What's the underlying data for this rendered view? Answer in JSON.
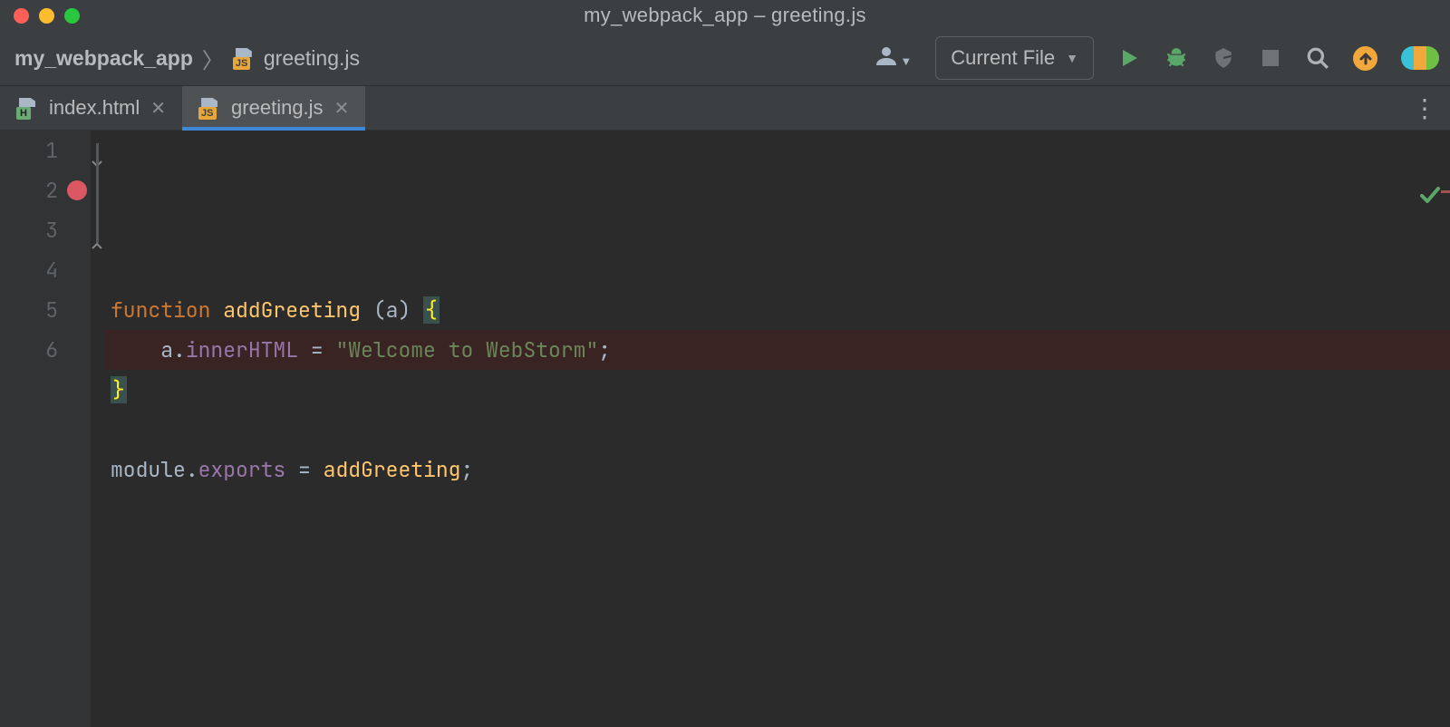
{
  "titlebar": {
    "title": "my_webpack_app – greeting.js",
    "traffic": {
      "close": "#FF5F57",
      "min": "#FEBC2E",
      "max": "#28C840"
    }
  },
  "toolbar": {
    "crumbs": {
      "project": "my_webpack_app",
      "file": "greeting.js"
    },
    "config_label": "Current File"
  },
  "tabs": [
    {
      "label": "index.html",
      "icon": "html",
      "active": false
    },
    {
      "label": "greeting.js",
      "icon": "js",
      "active": true
    }
  ],
  "editor": {
    "breakpoint_line": 2,
    "lines": [
      {
        "n": 1,
        "tokens": [
          {
            "t": "function ",
            "c": "kw"
          },
          {
            "t": "addGreeting ",
            "c": "fn"
          },
          {
            "t": "(",
            "c": "punct"
          },
          {
            "t": "a",
            "c": "param"
          },
          {
            "t": ") ",
            "c": "punct"
          },
          {
            "t": "{",
            "c": "brace"
          }
        ]
      },
      {
        "n": 2,
        "bp": true,
        "tokens": [
          {
            "t": "    ",
            "c": "punct"
          },
          {
            "t": "a",
            "c": "ident"
          },
          {
            "t": ".",
            "c": "punct"
          },
          {
            "t": "innerHTML",
            "c": "prop"
          },
          {
            "t": " = ",
            "c": "op"
          },
          {
            "t": "\"Welcome to WebStorm\"",
            "c": "str"
          },
          {
            "t": ";",
            "c": "punct"
          }
        ]
      },
      {
        "n": 3,
        "tokens": [
          {
            "t": "}",
            "c": "brace"
          }
        ]
      },
      {
        "n": 4,
        "tokens": []
      },
      {
        "n": 5,
        "tokens": [
          {
            "t": "module",
            "c": "ident"
          },
          {
            "t": ".",
            "c": "punct"
          },
          {
            "t": "exports",
            "c": "prop"
          },
          {
            "t": " = ",
            "c": "op"
          },
          {
            "t": "addGreeting",
            "c": "fn"
          },
          {
            "t": ";",
            "c": "punct"
          }
        ]
      },
      {
        "n": 6,
        "tokens": []
      }
    ]
  }
}
